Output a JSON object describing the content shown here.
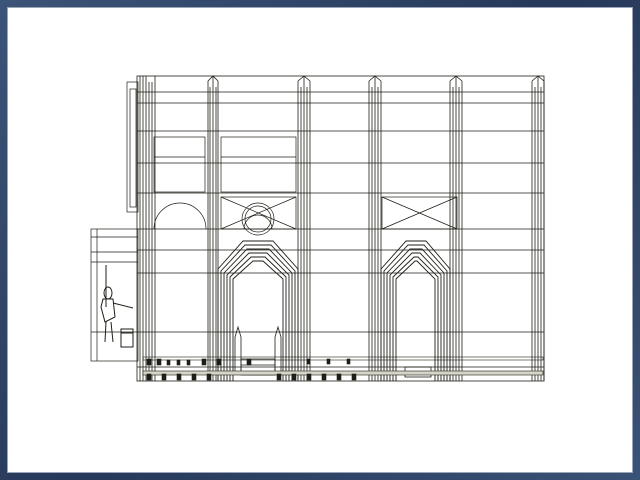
{
  "viewport": {
    "background": "#ffffff",
    "frame_color": "#2f4466",
    "line_color": "#1e1e16",
    "mode": "wireframe"
  },
  "model": {
    "subject": "gothic-arcade-wall",
    "pillars": 6,
    "arches": 2,
    "pinnacles": 2,
    "figures": 1
  }
}
